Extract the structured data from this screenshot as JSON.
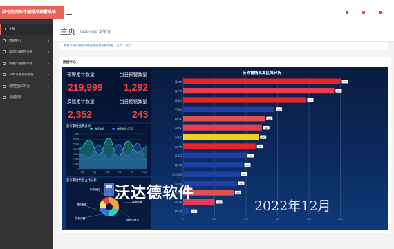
{
  "header": {
    "app_title": "反电信网络诈骗精准预警系统",
    "top_icons": [
      "mail-icon",
      "bell-icon",
      "user-icon"
    ]
  },
  "sidebar": {
    "items": [
      {
        "label": "主页",
        "icon": "home-icon",
        "active": true
      },
      {
        "label": "数据中心",
        "icon": "monitor-icon",
        "has_children": true
      },
      {
        "label": "电话诈骗预警系统",
        "icon": "phone-icon",
        "has_children": true
      },
      {
        "label": "网络诈骗预警系统",
        "icon": "network-icon",
        "has_children": true
      },
      {
        "label": "APP 诈骗预警系统",
        "icon": "app-icon",
        "has_children": true
      },
      {
        "label": "预警回复工作台",
        "icon": "reply-icon",
        "has_children": true
      },
      {
        "label": "系统管理",
        "icon": "gear-icon",
        "has_children": false
      }
    ]
  },
  "page": {
    "title": "主页",
    "welcome": "Welcome 李警官",
    "breadcrumb": [
      "警智公安反电信网络诈骗精准预警系统",
      "主页",
      "主页"
    ],
    "panel_title": "数据中心"
  },
  "stats": {
    "warn_total_label": "预警累计数量",
    "warn_today_label": "当日预警数量",
    "warn_total": "219,999",
    "warn_today": "1,292",
    "feedback_total_label": "反馈累计数量",
    "feedback_today_label": "当日反馈数量",
    "feedback_total": "2,352",
    "feedback_today": "243"
  },
  "chart_data": [
    {
      "type": "area",
      "title": "反诈警情趋势分析",
      "legend": [
        "电话数量",
        "金额数量（万元）"
      ],
      "x": [
        "1月",
        "3月",
        "5月",
        "7月",
        "9月",
        "11月"
      ],
      "y_ticks": [
        "7,000",
        "6,000",
        "5,000",
        "4,000",
        "3,000",
        "2,000",
        "1,000",
        "0"
      ],
      "ylim": [
        0,
        7000
      ],
      "series": [
        {
          "name": "电话数量",
          "color": "#2fd3b0",
          "values": [
            4200,
            5800,
            3000,
            6200,
            2600,
            5600,
            3400,
            4600
          ]
        },
        {
          "name": "金额数量（万元）",
          "color": "#3a74d6",
          "values": [
            3000,
            2400,
            4800,
            2200,
            5000,
            2800,
            5200,
            1800
          ]
        }
      ]
    },
    {
      "type": "pie",
      "title": "反诈警情类型占比分析",
      "labels": [
        "刷单返利",
        "冒充客服",
        "贷款诈骗",
        "其他诈骗",
        "冒充公检法"
      ],
      "colors": [
        "#f7a23b",
        "#2fd3b0",
        "#3a74d6",
        "#f5e463",
        "#ef4040"
      ],
      "values": [
        30,
        22,
        20,
        15,
        13
      ]
    },
    {
      "type": "bar",
      "orientation": "horizontal",
      "title": "反诈警情高发区域分析",
      "categories": [
        "澳州市",
        "南宁市",
        "晋城市",
        "平顶山",
        "泉山区",
        "丰台区",
        "沙坪区",
        "六户市",
        "雨花区",
        "黄平市",
        "江东新区",
        "汉川市",
        "西宁市",
        "光山县",
        "莎车县"
      ],
      "values": [
        1000,
        960,
        780,
        580,
        520,
        500,
        480,
        460,
        400,
        380,
        360,
        340,
        320,
        200,
        40
      ],
      "colors": [
        "#e8232a",
        "#e23d52",
        "#e8232a",
        "#1f3fa8",
        "#e05050",
        "#e23d52",
        "#f0d01c",
        "#e8232a",
        "#1f3fa8",
        "#1f3fa8",
        "#1f3fa8",
        "#1f3fa8",
        "#e05050",
        "#e23d52",
        "#1f3fa8"
      ],
      "value_labels": [
        "1000",
        "960",
        "780",
        "580",
        "520",
        "500",
        "480",
        "460",
        "400",
        "380",
        "360",
        "340",
        "320",
        "200",
        "40"
      ],
      "xlim": [
        0,
        1200
      ],
      "x_ticks": [
        "0",
        "200",
        "400",
        "600",
        "800",
        "1000"
      ]
    }
  ],
  "watermark": {
    "company": "沃达德软件",
    "date": "2022年12月"
  }
}
